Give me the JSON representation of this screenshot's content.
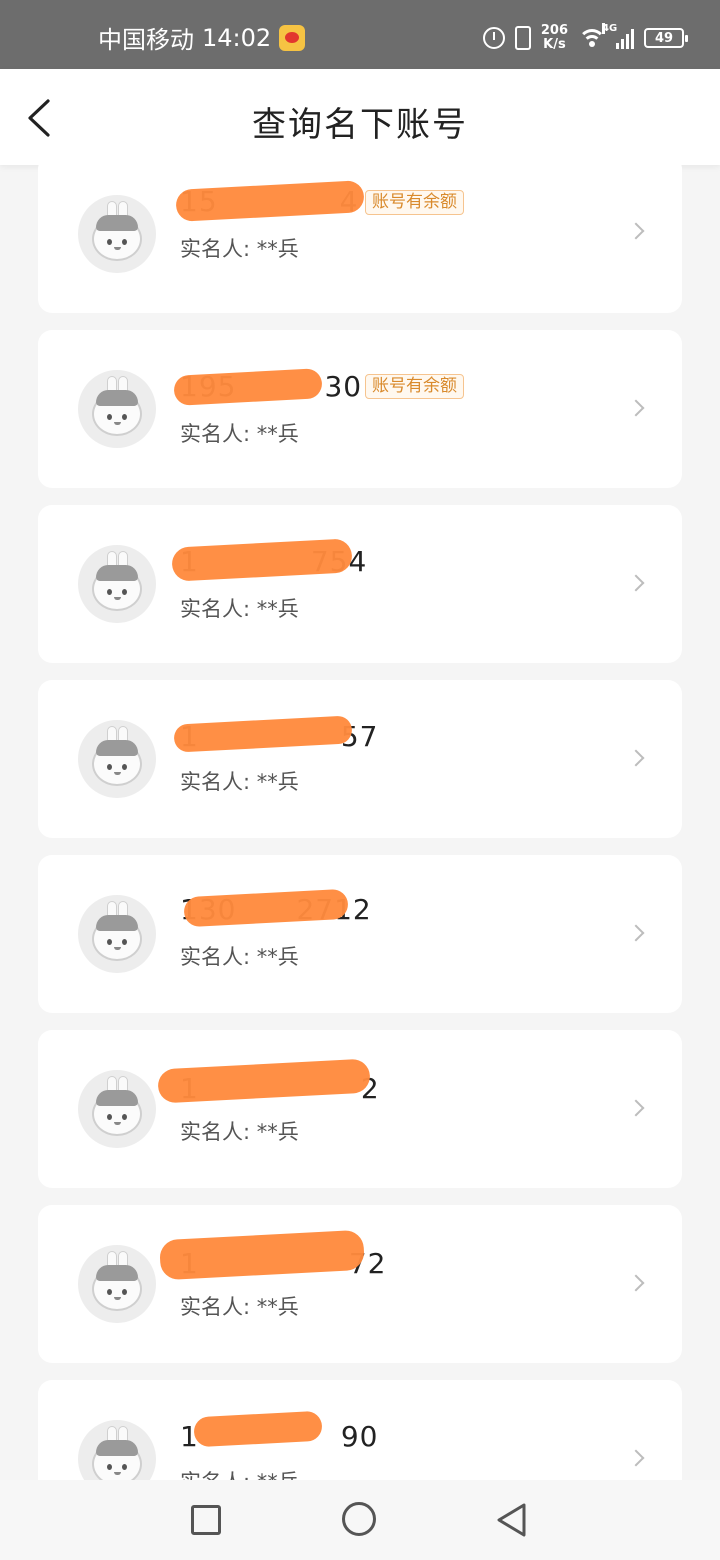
{
  "status_bar": {
    "carrier": "中国移动",
    "time": "14:02",
    "net_speed_value": "206",
    "net_speed_unit": "K/s",
    "network_type": "4G",
    "battery": "49",
    "icons": [
      "weibo-icon",
      "alarm-icon",
      "vibrate-icon",
      "wifi-icon",
      "signal-icon",
      "battery-icon"
    ]
  },
  "header": {
    "title": "查询名下账号",
    "back_icon": "chevron-left"
  },
  "accounts": [
    {
      "phone_visible": "15",
      "phone_suffix": "4",
      "badge": "账号有余额",
      "realname": "实名人:  **兵"
    },
    {
      "phone_visible": "195",
      "phone_suffix": "30",
      "badge": "账号有余额",
      "realname": "实名人:  **兵"
    },
    {
      "phone_visible": "1",
      "phone_suffix": "754",
      "badge": "",
      "realname": "实名人:  **兵"
    },
    {
      "phone_visible": "1",
      "phone_suffix": "57",
      "badge": "",
      "realname": "实名人:  **兵"
    },
    {
      "phone_visible": "130",
      "phone_suffix": "2712",
      "badge": "",
      "realname": "实名人:  **兵"
    },
    {
      "phone_visible": "1",
      "phone_suffix": "2",
      "badge": "",
      "realname": "实名人:  **兵"
    },
    {
      "phone_visible": "1",
      "phone_suffix": "72",
      "badge": "",
      "realname": "实名人:  **兵"
    },
    {
      "phone_visible": "1",
      "phone_suffix": "90",
      "badge": "",
      "realname": "实名人:  **兵"
    }
  ],
  "colors": {
    "status_bar_bg": "#6d6d6d",
    "page_bg": "#f5f5f5",
    "card_bg": "#ffffff",
    "redaction": "#ff8a3d",
    "badge_text": "#d98a2c",
    "badge_border": "#f6c48f"
  }
}
